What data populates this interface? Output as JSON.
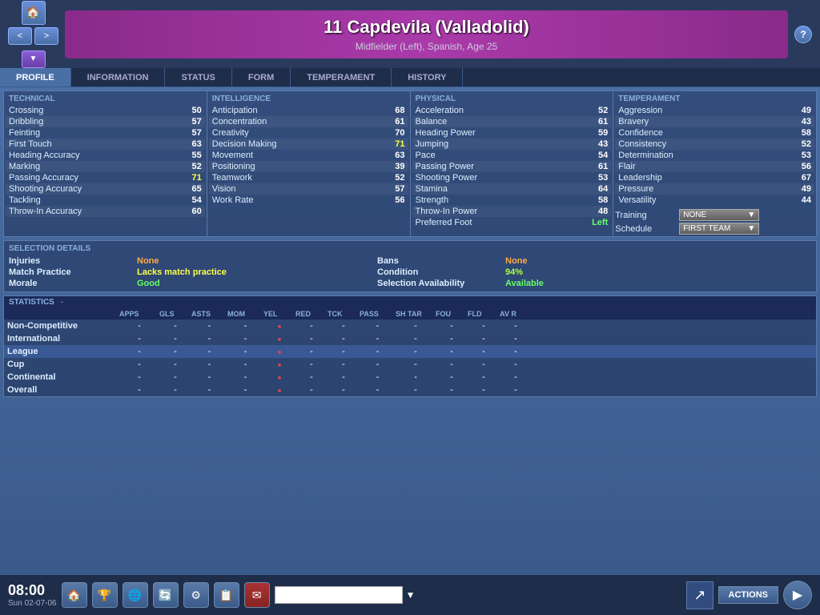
{
  "header": {
    "player_number": "11",
    "player_name": "Capdevila (Valladolid)",
    "player_full_title": "11 Capdevila (Valladolid)",
    "player_details": "Midfielder (Left), Spanish, Age 25",
    "nav_arrows": "< >",
    "dropdown_symbol": "▼"
  },
  "nav_tabs": {
    "profile": "PROFILE",
    "information": "INFORMATION",
    "status": "STATUS",
    "form": "FORM",
    "temperament": "TEMPERAMENT",
    "history": "HISTORY"
  },
  "technical": {
    "label": "TECHNICAL",
    "attributes": [
      {
        "name": "Crossing",
        "value": "50"
      },
      {
        "name": "Dribbling",
        "value": "57"
      },
      {
        "name": "Feinting",
        "value": "57"
      },
      {
        "name": "First Touch",
        "value": "63"
      },
      {
        "name": "Heading Accuracy",
        "value": "55"
      },
      {
        "name": "Marking",
        "value": "52"
      },
      {
        "name": "Passing Accuracy",
        "value": "71",
        "highlight": true
      },
      {
        "name": "Shooting Accuracy",
        "value": "65"
      },
      {
        "name": "Tackling",
        "value": "54"
      },
      {
        "name": "Throw-In Accuracy",
        "value": "60"
      }
    ]
  },
  "intelligence": {
    "label": "INTELLIGENCE",
    "attributes": [
      {
        "name": "Anticipation",
        "value": "68"
      },
      {
        "name": "Concentration",
        "value": "61"
      },
      {
        "name": "Creativity",
        "value": "70"
      },
      {
        "name": "Decision Making",
        "value": "71",
        "highlight": true
      },
      {
        "name": "Movement",
        "value": "63"
      },
      {
        "name": "Positioning",
        "value": "39"
      },
      {
        "name": "Teamwork",
        "value": "52"
      },
      {
        "name": "Vision",
        "value": "57"
      },
      {
        "name": "Work Rate",
        "value": "56"
      }
    ]
  },
  "physical": {
    "label": "PHYSICAL",
    "attributes": [
      {
        "name": "Acceleration",
        "value": "52"
      },
      {
        "name": "Balance",
        "value": "61"
      },
      {
        "name": "Heading Power",
        "value": "59"
      },
      {
        "name": "Jumping",
        "value": "43"
      },
      {
        "name": "Pace",
        "value": "54"
      },
      {
        "name": "Passing Power",
        "value": "61"
      },
      {
        "name": "Shooting Power",
        "value": "53"
      },
      {
        "name": "Stamina",
        "value": "64"
      },
      {
        "name": "Strength",
        "value": "58"
      },
      {
        "name": "Throw-In Power",
        "value": "48"
      },
      {
        "name": "Preferred Foot",
        "value": "Left",
        "special": true
      }
    ]
  },
  "temperament": {
    "label": "TEMPERAMENT",
    "attributes": [
      {
        "name": "Aggression",
        "value": "49"
      },
      {
        "name": "Bravery",
        "value": "43"
      },
      {
        "name": "Confidence",
        "value": "58"
      },
      {
        "name": "Consistency",
        "value": "52"
      },
      {
        "name": "Determination",
        "value": "53"
      },
      {
        "name": "Flair",
        "value": "56"
      },
      {
        "name": "Leadership",
        "value": "67"
      },
      {
        "name": "Pressure",
        "value": "49"
      },
      {
        "name": "Versatility",
        "value": "44"
      }
    ],
    "training_label": "Training",
    "training_value": "NONE",
    "schedule_label": "Schedule",
    "schedule_value": "FIRST TEAM"
  },
  "selection": {
    "title": "SELECTION DETAILS",
    "fields": [
      {
        "label": "Injuries",
        "value": "None",
        "color": "orange"
      },
      {
        "label": "Bans",
        "value": "None",
        "color": "orange"
      },
      {
        "label": "Match Practice",
        "value": "Lacks match practice",
        "color": "yellow"
      },
      {
        "label": "Condition",
        "value": "94%",
        "color": "lime"
      },
      {
        "label": "Morale",
        "value": "Good",
        "color": "green"
      },
      {
        "label": "Selection Availability",
        "value": "Available",
        "color": "green"
      }
    ]
  },
  "statistics": {
    "title": "STATISTICS",
    "dash": "-",
    "columns": [
      "",
      "APPS",
      "GLS",
      "ASTS",
      "MOM",
      "YEL",
      "RED",
      "TCK",
      "PASS",
      "SH TAR",
      "FOU",
      "FLD",
      "AV R"
    ],
    "rows": [
      {
        "name": "Non-Competitive",
        "selected": false,
        "values": [
          "-",
          "-",
          "-",
          "-",
          "-",
          "-",
          "-",
          "-",
          "-",
          "-",
          "-",
          "-"
        ]
      },
      {
        "name": "International",
        "selected": false,
        "values": [
          "-",
          "-",
          "-",
          "-",
          "-",
          "-",
          "-",
          "-",
          "-",
          "-",
          "-",
          "-"
        ]
      },
      {
        "name": "League",
        "selected": true,
        "values": [
          "-",
          "-",
          "-",
          "-",
          "-",
          "-",
          "-",
          "-",
          "-",
          "-",
          "-",
          "-"
        ]
      },
      {
        "name": "Cup",
        "selected": false,
        "values": [
          "-",
          "-",
          "-",
          "-",
          "-",
          "-",
          "-",
          "-",
          "-",
          "-",
          "-",
          "-"
        ]
      },
      {
        "name": "Continental",
        "selected": false,
        "values": [
          "-",
          "-",
          "-",
          "-",
          "-",
          "-",
          "-",
          "-",
          "-",
          "-",
          "-",
          "-"
        ]
      },
      {
        "name": "Overall",
        "selected": false,
        "values": [
          "-",
          "-",
          "-",
          "-",
          "-",
          "-",
          "-",
          "-",
          "-",
          "-",
          "-",
          "-"
        ]
      }
    ]
  },
  "bottom_bar": {
    "time": "08:00",
    "date": "Sun 02-07-06",
    "actions_label": "ACTIONS",
    "icons": [
      "🏠",
      "🏆",
      "🌐",
      "🔄",
      "⚙",
      "📋",
      "✉"
    ]
  }
}
